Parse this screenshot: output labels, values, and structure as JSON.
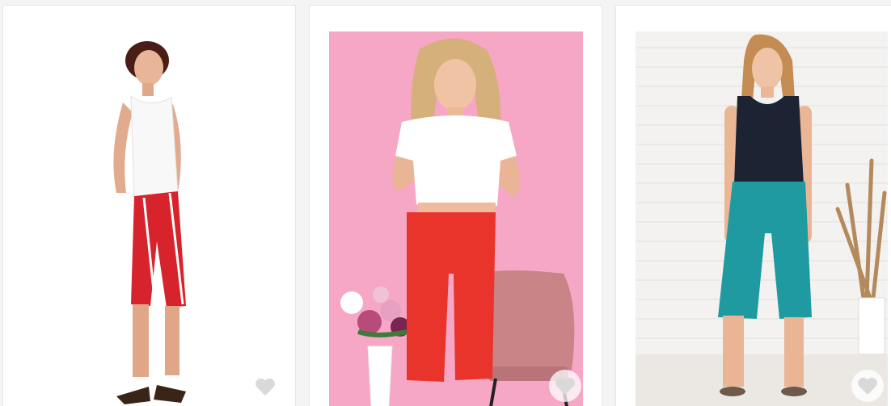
{
  "products": [
    {
      "image": "woman-in-white-tank-top-and-red-striped-capri-pants",
      "favorite_icon": "heart-icon",
      "favorite_active": false
    },
    {
      "image": "woman-in-white-t-shirt-and-red-capri-leggings",
      "favorite_icon": "heart-icon",
      "favorite_active": false
    },
    {
      "image": "woman-in-navy-tank-top-and-teal-capri-pants",
      "favorite_icon": "heart-icon",
      "favorite_active": false
    }
  ],
  "colors": {
    "heart": "#d9d9d9",
    "card_border": "#e6e6e6",
    "pink_backdrop": "#f7a8c6",
    "red_pants": "#e8342a",
    "teal_pants": "#1e9aa0",
    "navy_top": "#1c2433"
  }
}
